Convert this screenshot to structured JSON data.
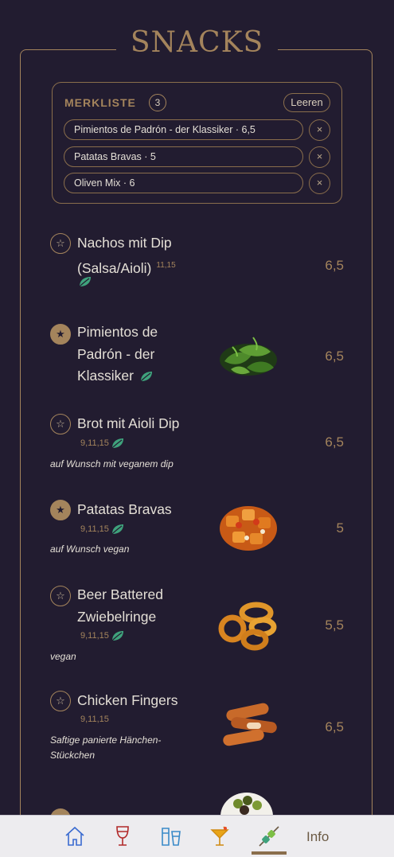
{
  "page": {
    "title": "SNACKS"
  },
  "merkliste": {
    "label": "MERKLISTE",
    "count": "3",
    "clear_label": "Leeren",
    "items": [
      {
        "label": "Pimientos de Padrón - der Klassiker · 6,5",
        "remove": "×"
      },
      {
        "label": "Patatas Bravas · 5",
        "remove": "×"
      },
      {
        "label": "Oliven Mix · 6",
        "remove": "×"
      }
    ]
  },
  "menu": {
    "items": [
      {
        "name_line1": "Nachos mit Dip",
        "name_line2": "(Salsa/Aioli)",
        "codes": "11,15",
        "vegan_icon": "leaf-icon",
        "price": "6,5",
        "favorite": false,
        "star": "☆"
      },
      {
        "name_line1": "Pimientos de",
        "name_line2": "Padrón - der",
        "name_line3": "Klassiker",
        "vegan_icon": "leaf-icon",
        "price": "6,5",
        "favorite": true,
        "star": "★",
        "image": "green-peppers"
      },
      {
        "name_line1": "Brot mit Aioli Dip",
        "codes": "9,11,15",
        "vegan_icon": "leaf-icon",
        "note": "auf Wunsch mit veganem dip",
        "price": "6,5",
        "favorite": false,
        "star": "☆"
      },
      {
        "name_line1": "Patatas Bravas",
        "codes": "9,11,15",
        "vegan_icon": "leaf-icon",
        "note": "auf Wunsch vegan",
        "price": "5",
        "favorite": true,
        "star": "★",
        "image": "patatas-bravas"
      },
      {
        "name_line1": "Beer Battered",
        "name_line2": "Zwiebelringe",
        "codes": "9,11,15",
        "vegan_icon": "leaf-icon",
        "note": "vegan",
        "price": "5,5",
        "favorite": false,
        "star": "☆",
        "image": "onion-rings"
      },
      {
        "name_line1": "Chicken Fingers",
        "codes": "9,11,15",
        "note_line1": "Saftige panierte Hänchen-",
        "note_line2": "Stückchen",
        "price": "6,5",
        "favorite": false,
        "star": "☆",
        "image": "chicken-fingers"
      }
    ]
  },
  "nav": {
    "items": [
      "home-icon",
      "wine-glass-icon",
      "beer-glasses-icon",
      "cocktail-icon",
      "skewer-icon"
    ],
    "info_label": "Info",
    "active": "skewer-icon"
  },
  "colors": {
    "background": "#221c30",
    "accent": "#a4845c",
    "text": "#e4dfd6",
    "vegan_leaf": "#3fa27c",
    "navbar": "#edecef"
  }
}
